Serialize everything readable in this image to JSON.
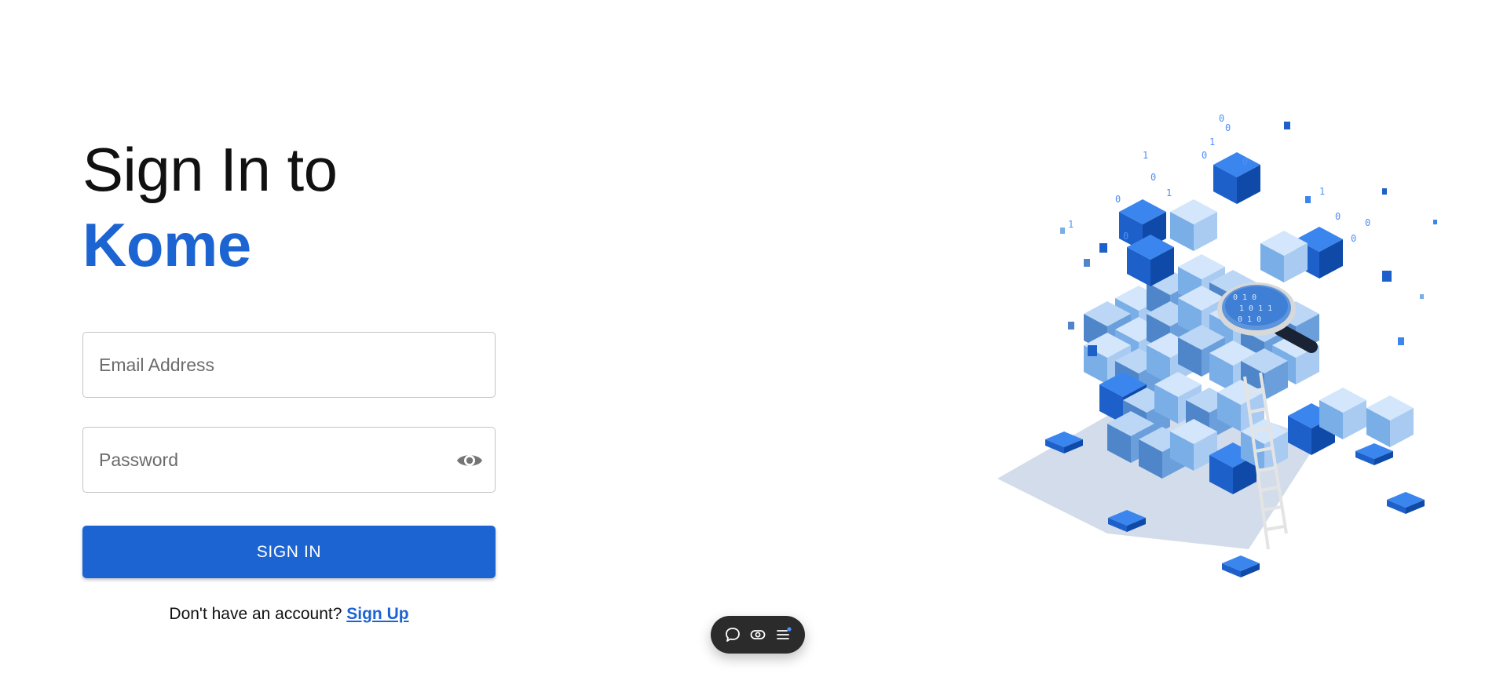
{
  "title": {
    "prefix": "Sign In to ",
    "brand": "Kome"
  },
  "form": {
    "email_placeholder": "Email Address",
    "email_value": "",
    "password_placeholder": "Password",
    "password_value": "",
    "password_toggle_icon": "eye-icon",
    "submit_label": "SIGN IN"
  },
  "signup": {
    "prompt": "Don't have an account? ",
    "link_label": "Sign Up"
  },
  "toolbar": {
    "icons": [
      "comment-icon",
      "visibility-icon",
      "menu-icon"
    ]
  },
  "colors": {
    "brand": "#1c64d2",
    "toolbar_bg": "#2b2b2b",
    "toolbar_dot": "#4f8ff7"
  }
}
